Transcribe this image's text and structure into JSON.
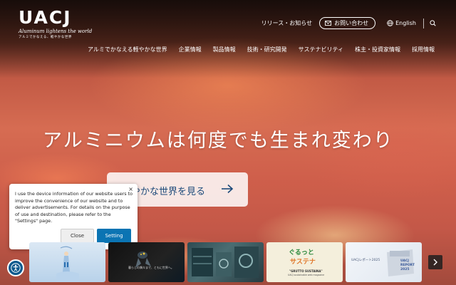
{
  "header": {
    "logo": "UACJ",
    "tagline": "Aluminum lightens the world",
    "tagline_ja": "アルミでかなえる、軽やかな世界",
    "news_link": "リリース・お知らせ",
    "contact_button": "お問い合わせ",
    "language": "English"
  },
  "nav": {
    "items": [
      {
        "label": "アルミでかなえる軽やかな世界"
      },
      {
        "label": "企業情報"
      },
      {
        "label": "製品情報"
      },
      {
        "label": "技術・研究開発"
      },
      {
        "label": "サステナビリティ"
      },
      {
        "label": "株主・投資家情報"
      },
      {
        "label": "採用情報"
      }
    ]
  },
  "hero": {
    "headline": "アルミニウムは何度でも生まれ変わり",
    "cta_label": "やかな世界を見る"
  },
  "cookie": {
    "message": "I use the device information of our website users to improve the convenience of our website and to deliver advertisements. For details on the purpose of use and destination, please refer to the \"Settings\" page.",
    "close_label": "Close",
    "setting_label": "Setting",
    "dismiss_glyph": "×"
  },
  "carousel": {
    "slide2_caption": "暮らしの隅々まで、ともに世界へ。",
    "slide4_title_line1": "ぐるっと",
    "slide4_title_line2": "サステナ",
    "slide4_subtitle": "\"GRUTTO SUSTAINA\"",
    "slide4_subtitle2": "UACJ sustainable web magazine",
    "slide5_caption": "UACJレポート2025",
    "slide5_report_1": "UACJ",
    "slide5_report_2": "REPORT",
    "slide5_report_3": "2025"
  },
  "colors": {
    "brand_blue": "#1c4a7a",
    "setting_button": "#0b74b3",
    "accessibility_button": "#0c5a8e"
  }
}
